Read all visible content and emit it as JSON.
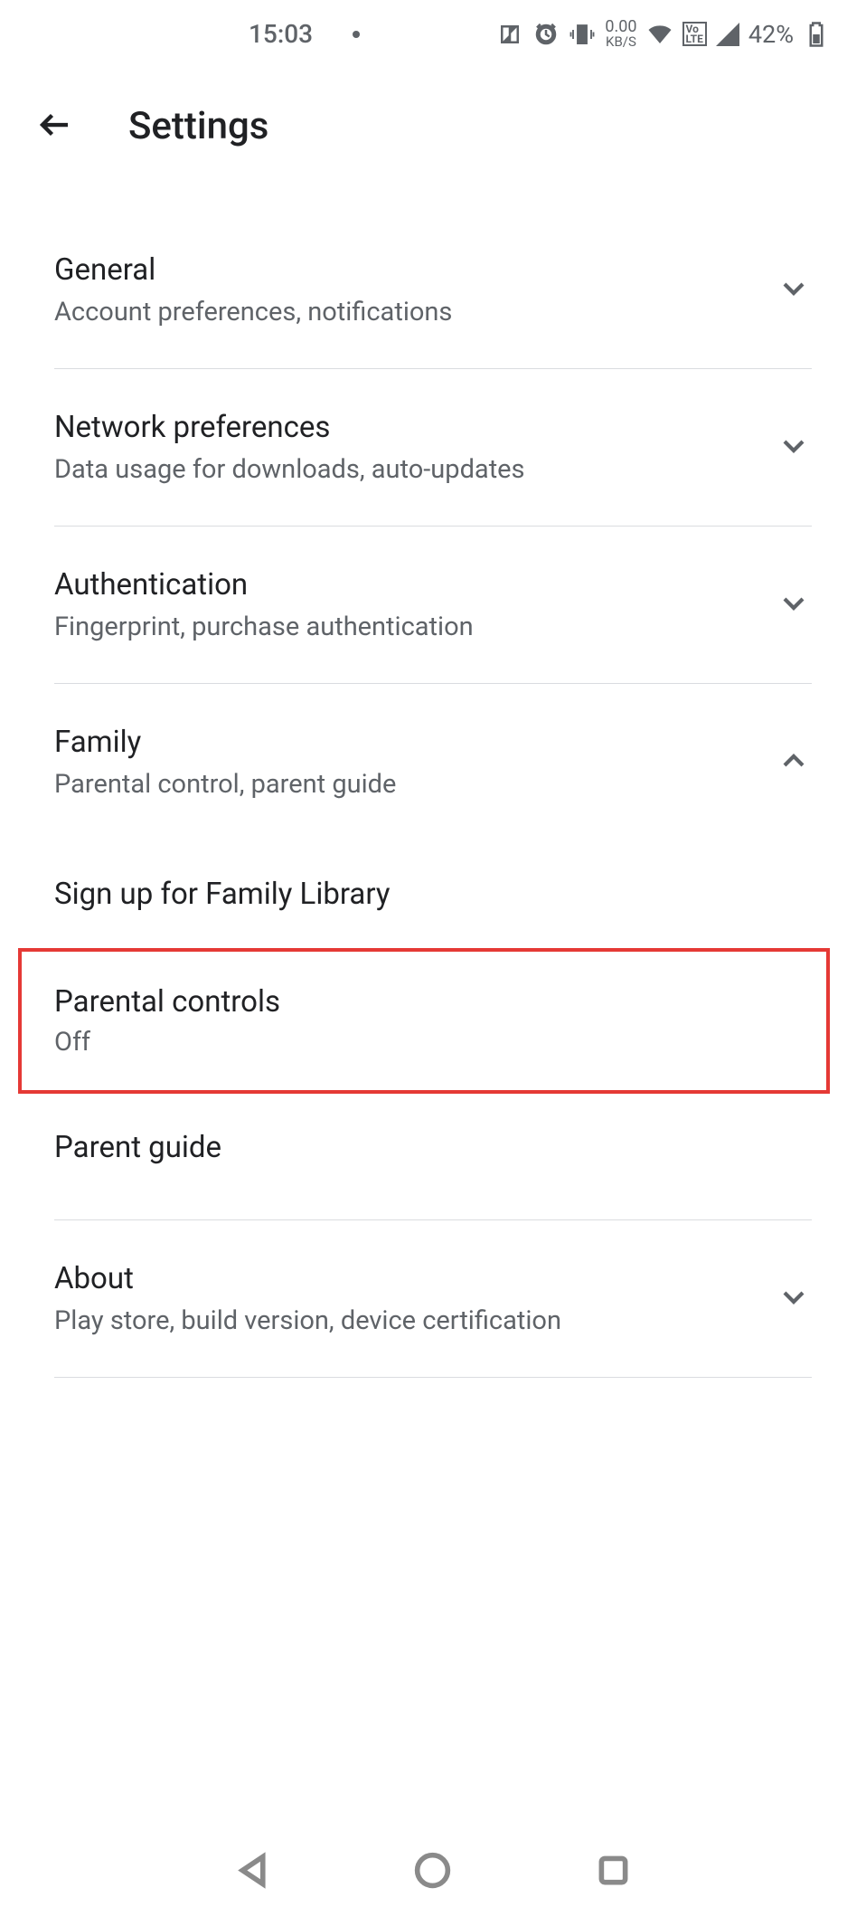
{
  "status_bar": {
    "time": "15:03",
    "data_rate_top": "0.00",
    "data_rate_bottom": "KB/S",
    "volte": "VoLTE",
    "battery": "42%"
  },
  "header": {
    "title": "Settings"
  },
  "sections": {
    "general": {
      "title": "General",
      "subtitle": "Account preferences, notifications"
    },
    "network": {
      "title": "Network preferences",
      "subtitle": "Data usage for downloads, auto-updates"
    },
    "authentication": {
      "title": "Authentication",
      "subtitle": "Fingerprint, purchase authentication"
    },
    "family": {
      "title": "Family",
      "subtitle": "Parental control, parent guide",
      "sub_items": {
        "signup": "Sign up for Family Library",
        "parental_controls": {
          "title": "Parental controls",
          "status": "Off"
        },
        "parent_guide": "Parent guide"
      }
    },
    "about": {
      "title": "About",
      "subtitle": "Play store, build version, device certification"
    }
  }
}
